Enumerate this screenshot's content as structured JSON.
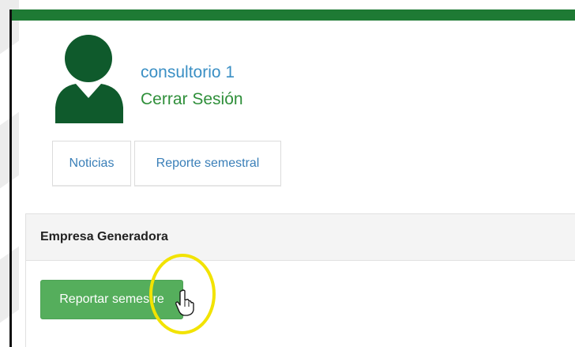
{
  "header": {
    "accent_color": "#1e7a34"
  },
  "user": {
    "avatar_icon": "user-silhouette-icon",
    "avatar_color": "#0f5a2c",
    "name": "consultorio 1",
    "logout_label": "Cerrar Sesión"
  },
  "tabs": [
    {
      "label": "Noticias"
    },
    {
      "label": "Reporte semestral"
    }
  ],
  "panel": {
    "title": "Empresa Generadora",
    "button_label": "Reportar semestre",
    "button_color": "#55ae5c"
  },
  "overlay": {
    "highlight_color": "#f2e300",
    "cursor_icon": "hand-pointer-icon"
  }
}
